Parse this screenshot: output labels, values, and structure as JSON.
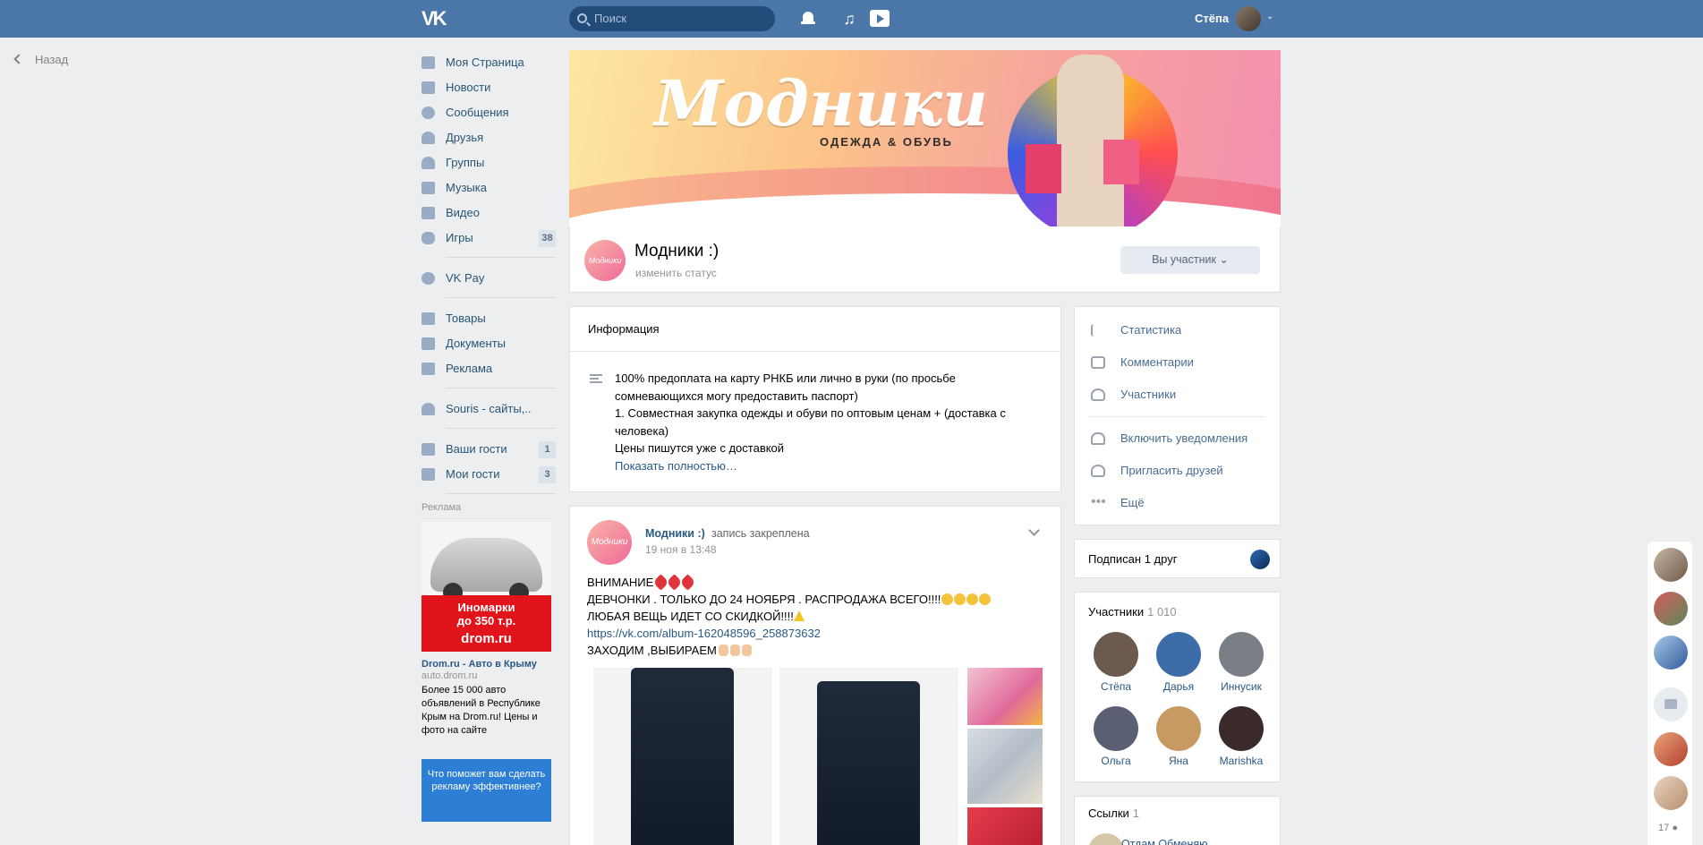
{
  "topbar": {
    "logo": "VK",
    "search_placeholder": "Поиск",
    "user_name": "Стёпа",
    "icons": [
      "bell-icon",
      "music-icon",
      "video-icon"
    ]
  },
  "back_label": "Назад",
  "left_nav": {
    "items": [
      {
        "label": "Моя Страница",
        "icon": "home-icon"
      },
      {
        "label": "Новости",
        "icon": "news-icon"
      },
      {
        "label": "Сообщения",
        "icon": "messages-icon"
      },
      {
        "label": "Друзья",
        "icon": "friends-icon"
      },
      {
        "label": "Группы",
        "icon": "groups-icon"
      },
      {
        "label": "Музыка",
        "icon": "music-icon"
      },
      {
        "label": "Видео",
        "icon": "video-icon"
      },
      {
        "label": "Игры",
        "icon": "games-icon",
        "count": "38"
      },
      {
        "label": "VK Pay",
        "icon": "vkpay-icon"
      },
      {
        "label": "Товары",
        "icon": "goods-icon"
      },
      {
        "label": "Документы",
        "icon": "documents-icon"
      },
      {
        "label": "Реклама",
        "icon": "ads-icon"
      },
      {
        "label": "Souris - сайты,..",
        "icon": "community-icon"
      },
      {
        "label": "Ваши гости",
        "icon": "apps-icon",
        "count": "1"
      },
      {
        "label": "Мои гости",
        "icon": "apps-icon",
        "count": "3"
      }
    ],
    "ad_label": "Реклама",
    "ad": {
      "image_line1": "Иномарки",
      "image_line2": "до 350 т.р.",
      "image_brand": "drom.ru",
      "title": "Drom.ru - Авто в Крыму",
      "domain": "auto.drom.ru",
      "text": "Более 15 000 авто объявлений в Республике Крым на Drom.ru! Цены и фото на сайте"
    },
    "ad2_text": "Что поможет вам сделать рекламу эффективнее?"
  },
  "group": {
    "cover_title": "Модники",
    "cover_subtitle": "ОДЕЖДА & ОБУВЬ",
    "avatar_text": "Модники",
    "name": "Модники :)",
    "status": "изменить статус",
    "member_button": "Вы участник"
  },
  "info": {
    "header": "Информация",
    "lines": [
      "100% предоплата на карту РНКБ или лично в руки (по просьбе сомневающихся могу предоставить паспорт)",
      "1. Совместная закупка одежды и обуви по оптовым ценам + (доставка с человека)",
      "Цены пишутся уже с доставкой"
    ],
    "show_more": "Показать полностью…"
  },
  "post": {
    "author": "Модники :)",
    "pinned": "запись закреплена",
    "date": "19 ноя в 13:48",
    "line1": "ВНИМАНИЕ",
    "line2": "ДЕВЧОНКИ . ТОЛЬКО ДО 24 НОЯБРЯ . РАСПРОДАЖА ВСЕГО!!!!",
    "line3": "ЛЮБАЯ ВЕЩЬ ИДЕТ СО СКИДКОЙ!!!!",
    "link": "https://vk.com/album-162048596_258873632",
    "line5": "ЗАХОДИМ ,ВЫБИРАЕМ"
  },
  "right_menu": {
    "items1": [
      {
        "label": "Статистика",
        "icon": "stats-icon"
      },
      {
        "label": "Комментарии",
        "icon": "comments-icon"
      },
      {
        "label": "Участники",
        "icon": "members-icon"
      }
    ],
    "items2": [
      {
        "label": "Включить уведомления",
        "icon": "bell-icon"
      },
      {
        "label": "Пригласить друзей",
        "icon": "invite-icon"
      },
      {
        "label": "Ещё",
        "icon": "more-icon"
      }
    ]
  },
  "friends_block": {
    "label": "Подписан 1 друг"
  },
  "members_block": {
    "title": "Участники",
    "count": "1 010",
    "people": [
      {
        "name": "Стёпа",
        "color": "#6b5a4d"
      },
      {
        "name": "Дарья",
        "color": "#3d6da8"
      },
      {
        "name": "Иннусик",
        "color": "#7a7f86"
      },
      {
        "name": "Ольга",
        "color": "#5b5f73"
      },
      {
        "name": "Яна",
        "color": "#c79a63"
      },
      {
        "name": "Marishka",
        "color": "#3a2a2a"
      }
    ]
  },
  "links_block": {
    "title": "Ссылки",
    "count": "1",
    "first": "Отдам Обменяю"
  },
  "chatbar": {
    "count": "17"
  },
  "colors": {
    "header": "#4a76a8",
    "link": "#2a5885",
    "background": "#edeef0"
  }
}
